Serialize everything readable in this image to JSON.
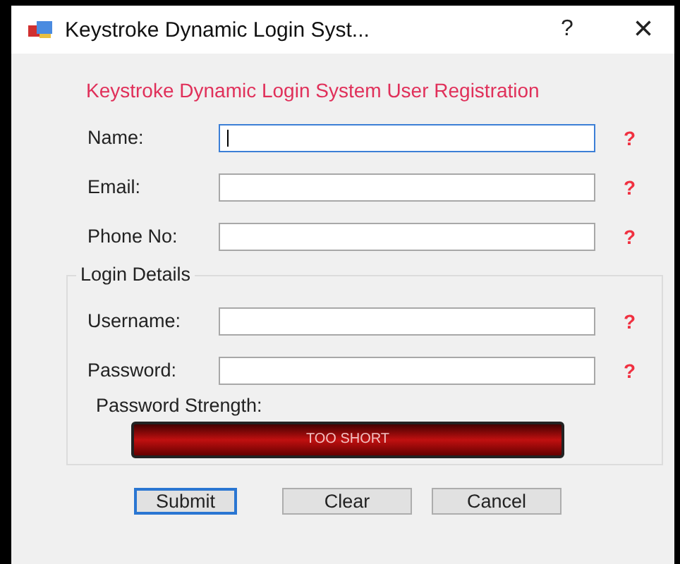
{
  "window": {
    "title": "Keystroke Dynamic Login Syst...",
    "help": "?",
    "close": "×"
  },
  "heading": "Keystroke Dynamic Login System User Registration",
  "fields": [
    {
      "label": "Name:",
      "focused": true,
      "hint": "?"
    },
    {
      "label": "Email:",
      "focused": false,
      "hint": "?"
    },
    {
      "label": "Phone No:",
      "focused": false,
      "hint": "?"
    }
  ],
  "login_details": {
    "legend": "Login Details",
    "fields": [
      {
        "label": "Username:",
        "focused": false,
        "hint": "?"
      },
      {
        "label": "Password:",
        "focused": false,
        "hint": "?"
      }
    ],
    "strength_label": "Password Strength:",
    "strength_text": "TOO SHORT"
  },
  "buttons": [
    {
      "label": "Submit",
      "default": true
    },
    {
      "label": "Clear",
      "default": false
    },
    {
      "label": "Cancel",
      "default": false
    }
  ]
}
